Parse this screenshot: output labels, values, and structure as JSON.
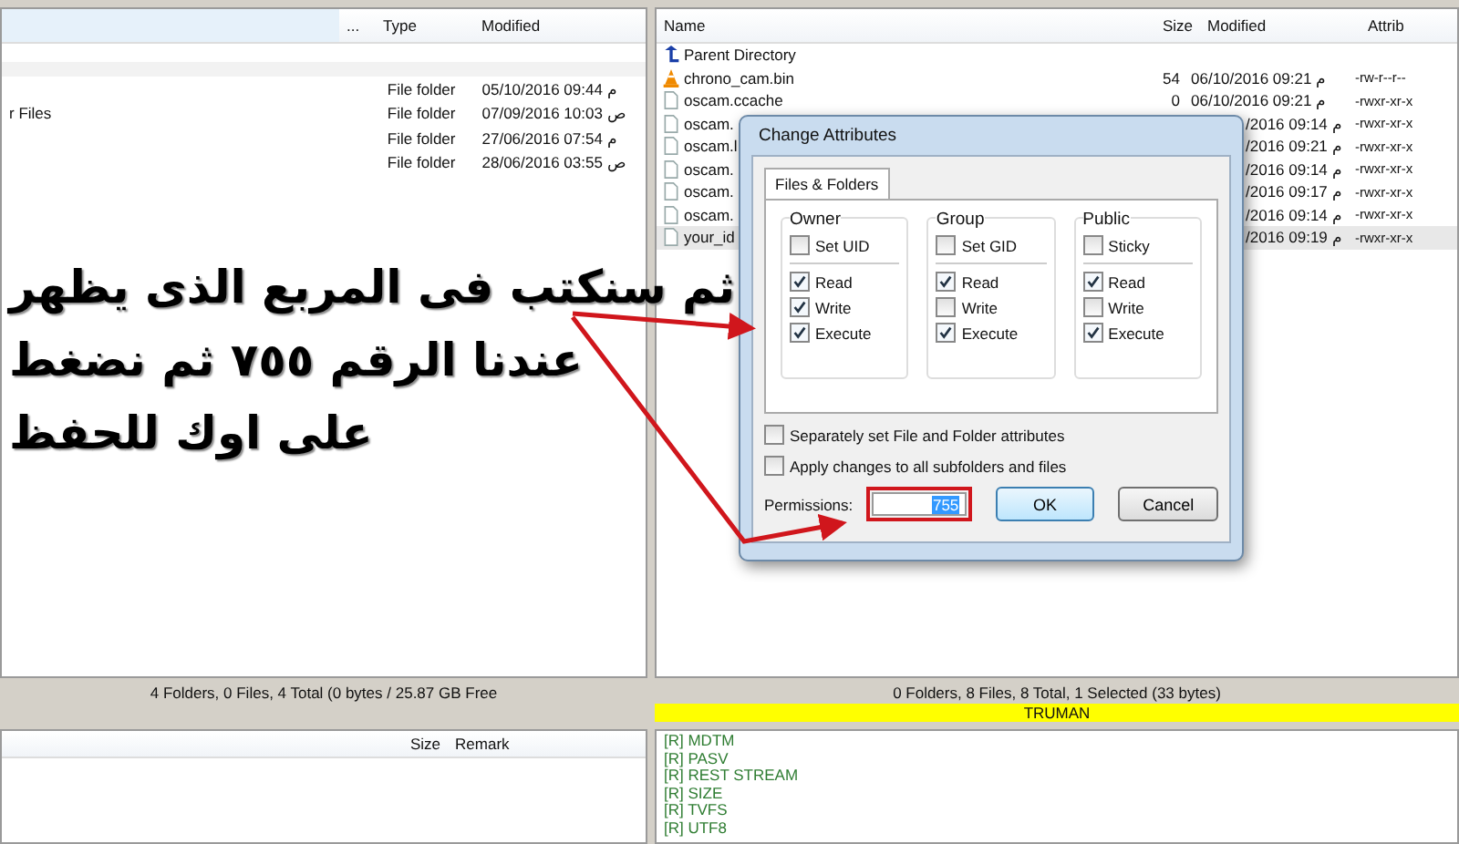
{
  "left_pane": {
    "columns": [
      {
        "label": "..."
      },
      {
        "label": "Type"
      },
      {
        "label": "Modified"
      }
    ],
    "rows": [
      {
        "name": "",
        "type": "File folder",
        "modified": "05/10/2016 09:44 م"
      },
      {
        "name": "r Files",
        "type": "File folder",
        "modified": "07/09/2016 10:03 ص"
      },
      {
        "name": "",
        "type": "File folder",
        "modified": "27/06/2016 07:54 م"
      },
      {
        "name": "",
        "type": "File folder",
        "modified": "28/06/2016 03:55 ص"
      }
    ],
    "status": "4 Folders, 0 Files, 4 Total (0 bytes / 25.87 GB Free",
    "bottom_columns": [
      "Size",
      "Remark"
    ]
  },
  "right_pane": {
    "columns": [
      {
        "label": "Name"
      },
      {
        "label": "Size"
      },
      {
        "label": "Modified"
      },
      {
        "label": "Attrib"
      }
    ],
    "rows": [
      {
        "kind": "parent",
        "name": "Parent Directory",
        "size": "",
        "modified": "",
        "attrib": "",
        "selected": false
      },
      {
        "kind": "media",
        "name": "chrono_cam.bin",
        "size": "54",
        "modified": "06/10/2016 09:21 م",
        "attrib": "-rw-r--r--",
        "selected": false
      },
      {
        "kind": "file",
        "name": "oscam.ccache",
        "size": "0",
        "modified": "06/10/2016 09:21 م",
        "attrib": "-rwxr-xr-x",
        "selected": false
      },
      {
        "kind": "file",
        "name": "oscam.",
        "size": "",
        "modified": "/2016 09:14 م",
        "attrib": "-rwxr-xr-x",
        "selected": false
      },
      {
        "kind": "file",
        "name": "oscam.l",
        "size": "",
        "modified": "/2016 09:21 م",
        "attrib": "-rwxr-xr-x",
        "selected": false
      },
      {
        "kind": "file",
        "name": "oscam.",
        "size": "",
        "modified": "/2016 09:14 م",
        "attrib": "-rwxr-xr-x",
        "selected": false
      },
      {
        "kind": "file",
        "name": "oscam.",
        "size": "",
        "modified": "/2016 09:17 م",
        "attrib": "-rwxr-xr-x",
        "selected": false
      },
      {
        "kind": "file",
        "name": "oscam.",
        "size": "",
        "modified": "/2016 09:14 م",
        "attrib": "-rwxr-xr-x",
        "selected": false
      },
      {
        "kind": "file",
        "name": "your_id",
        "size": "",
        "modified": "/2016 09:19 م",
        "attrib": "-rwxr-xr-x",
        "selected": true
      }
    ],
    "status": "0 Folders, 8 Files, 8 Total, 1 Selected (33 bytes)",
    "server_banner": "TRUMAN",
    "log": [
      "[R] MDTM",
      "[R] PASV",
      "[R] REST STREAM",
      "[R] SIZE",
      "[R] TVFS",
      "[R] UTF8"
    ]
  },
  "dialog": {
    "title": "Change Attributes",
    "tabs": [
      {
        "label": "Files & Folders",
        "selected": true
      }
    ],
    "groups": [
      {
        "title": "Owner",
        "special": {
          "label": "Set UID",
          "checked": false
        },
        "perms": [
          {
            "label": "Read",
            "checked": true
          },
          {
            "label": "Write",
            "checked": true
          },
          {
            "label": "Execute",
            "checked": true
          }
        ]
      },
      {
        "title": "Group",
        "special": {
          "label": "Set GID",
          "checked": false
        },
        "perms": [
          {
            "label": "Read",
            "checked": true
          },
          {
            "label": "Write",
            "checked": false
          },
          {
            "label": "Execute",
            "checked": true
          }
        ]
      },
      {
        "title": "Public",
        "special": {
          "label": "Sticky",
          "checked": false
        },
        "perms": [
          {
            "label": "Read",
            "checked": true
          },
          {
            "label": "Write",
            "checked": false
          },
          {
            "label": "Execute",
            "checked": true
          }
        ]
      }
    ],
    "options": [
      {
        "label": "Separately set File and Folder attributes",
        "checked": false
      },
      {
        "label": "Apply changes to all subfolders and files",
        "checked": false
      }
    ],
    "permissions_label": "Permissions:",
    "permissions_value": "755",
    "buttons": [
      {
        "label": "OK",
        "default": true
      },
      {
        "label": "Cancel",
        "default": false
      }
    ]
  },
  "annotation": [
    "ثم سنكتب فى المربع الذى يظهر",
    "عندنا الرقم ٧٥٥ ثم نضغط",
    "على اوك للحفظ"
  ]
}
